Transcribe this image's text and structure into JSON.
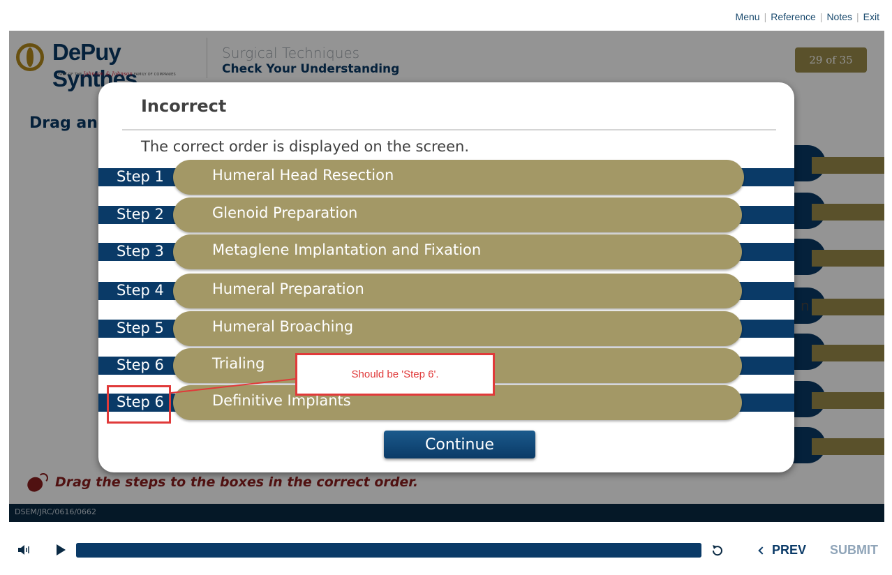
{
  "topnav": {
    "menu": "Menu",
    "reference": "Reference",
    "notes": "Notes",
    "exit": "Exit"
  },
  "header": {
    "logo_text": "DePuy Synthes",
    "logo_sub_prefix": "PART OF THE",
    "logo_sub_brand": "Johnson & Johnson",
    "logo_sub_suffix": "FAMILY OF COMPANIES",
    "title": "Surgical Techniques",
    "subtitle": "Check Your Understanding",
    "page_counter": "29 of 35"
  },
  "background": {
    "drag_title": "Drag and",
    "hint": "Drag the steps to the boxes in the correct order.",
    "footer_code": "DSEM/JRC/0616/0662",
    "partial_text": "n"
  },
  "modal": {
    "title": "Incorrect",
    "message": "The correct order is displayed on the screen.",
    "steps": [
      {
        "label": "Step 1",
        "text": "Humeral Head Resection"
      },
      {
        "label": "Step 2",
        "text": "Glenoid Preparation"
      },
      {
        "label": "Step 3",
        "text": "Metaglene Implantation and Fixation"
      },
      {
        "label": "Step 4",
        "text": "Humeral Preparation"
      },
      {
        "label": "Step 5",
        "text": "Humeral Broaching"
      },
      {
        "label": "Step 6",
        "text": "Trialing"
      },
      {
        "label": "Step 6",
        "text": "Definitive Implants"
      }
    ],
    "continue_label": "Continue"
  },
  "annotation": {
    "callout_text": "Should be 'Step 6'.",
    "color": "#e03a3a"
  },
  "player": {
    "progress": 1.0,
    "prev_label": "PREV",
    "submit_label": "SUBMIT"
  },
  "colors": {
    "navy": "#0a3a67",
    "gold": "#a39866",
    "accent_red": "#8b1e1e"
  }
}
